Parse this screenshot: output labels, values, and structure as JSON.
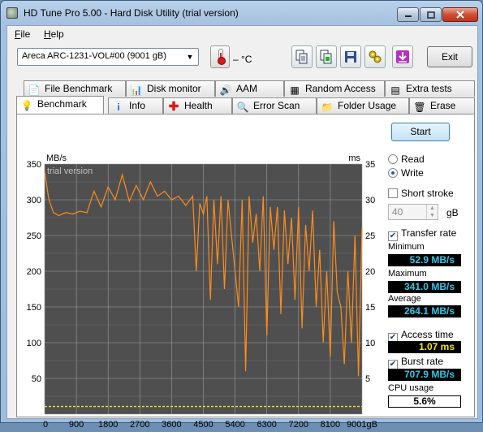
{
  "window": {
    "title": "HD Tune Pro 5.00 - Hard Disk Utility (trial version)"
  },
  "menu": [
    {
      "label": "File",
      "key": "F",
      "rest": "ile"
    },
    {
      "label": "Help",
      "key": "H",
      "rest": "elp"
    }
  ],
  "toolbar": {
    "drive": "Areca  ARC-1231-VOL#00  (9001 gB)",
    "temperature": "– °C",
    "icons": [
      "copy-info-icon",
      "copy-screenshot-icon",
      "save-icon",
      "options-icon",
      "download-icon"
    ],
    "exit_label": "Exit"
  },
  "tabs_top": [
    {
      "label": "File Benchmark",
      "icon": "file-benchmark-icon"
    },
    {
      "label": "Disk monitor",
      "icon": "disk-monitor-icon"
    },
    {
      "label": "AAM",
      "icon": "speaker-icon"
    },
    {
      "label": "Random Access",
      "icon": "random-access-icon"
    },
    {
      "label": "Extra tests",
      "icon": "extra-tests-icon"
    }
  ],
  "tabs_bottom": [
    {
      "label": "Benchmark",
      "icon": "benchmark-icon",
      "active": true
    },
    {
      "label": "Info",
      "icon": "info-icon"
    },
    {
      "label": "Health",
      "icon": "health-icon"
    },
    {
      "label": "Error Scan",
      "icon": "error-scan-icon"
    },
    {
      "label": "Folder Usage",
      "icon": "folder-icon"
    },
    {
      "label": "Erase",
      "icon": "trash-icon"
    }
  ],
  "controls": {
    "start_label": "Start",
    "read_label": "Read",
    "write_label": "Write",
    "mode": "Write",
    "short_stroke_label": "Short stroke",
    "short_stroke_checked": false,
    "short_stroke_value": "40",
    "short_stroke_unit": "gB",
    "transfer_rate_label": "Transfer rate",
    "transfer_rate_checked": true,
    "access_time_label": "Access time",
    "access_time_checked": true,
    "burst_rate_label": "Burst rate",
    "burst_rate_checked": true
  },
  "stats": {
    "minimum_label": "Minimum",
    "minimum": "52.9 MB/s",
    "maximum_label": "Maximum",
    "maximum": "341.0 MB/s",
    "average_label": "Average",
    "average": "264.1 MB/s",
    "access_time": "1.07 ms",
    "burst_rate": "707.9 MB/s",
    "cpu_label": "CPU usage",
    "cpu": "5.6%"
  },
  "chart_data": {
    "type": "line",
    "watermark": "trial version",
    "ylabel_left": "MB/s",
    "ylabel_right": "ms",
    "xlabel": "gB",
    "xlim": [
      0,
      9001
    ],
    "ylim_left": [
      0,
      350
    ],
    "ylim_right": [
      0,
      35
    ],
    "x_ticks": [
      "0",
      "900",
      "1800",
      "2700",
      "3600",
      "4500",
      "5400",
      "6300",
      "7200",
      "8100",
      "9001gB"
    ],
    "y_ticks_left": [
      "350",
      "300",
      "250",
      "200",
      "150",
      "100",
      "50"
    ],
    "y_ticks_right": [
      "35",
      "30",
      "25",
      "20",
      "15",
      "10",
      "5"
    ],
    "grid": true,
    "colors": {
      "transfer": "#ff8c1a",
      "access": "#f2e21a",
      "grid": "#9aa0a0",
      "background": "#4f4f4f"
    },
    "series": [
      {
        "name": "Transfer rate",
        "x": [
          0,
          120,
          250,
          400,
          600,
          800,
          1000,
          1200,
          1400,
          1600,
          1800,
          2000,
          2200,
          2400,
          2600,
          2800,
          3000,
          3200,
          3400,
          3600,
          3800,
          4000,
          4200,
          4300,
          4400,
          4500,
          4600,
          4700,
          4800,
          4900,
          5000,
          5100,
          5200,
          5300,
          5400,
          5500,
          5600,
          5700,
          5800,
          5900,
          6000,
          6100,
          6200,
          6300,
          6400,
          6500,
          6600,
          6700,
          6800,
          6900,
          7000,
          7100,
          7200,
          7300,
          7400,
          7500,
          7600,
          7700,
          7800,
          7900,
          8000,
          8100,
          8200,
          8300,
          8400,
          8500,
          8600,
          8700,
          8800,
          8900,
          9001
        ],
        "values": [
          340,
          300,
          282,
          278,
          282,
          280,
          284,
          282,
          312,
          290,
          318,
          300,
          335,
          298,
          320,
          300,
          325,
          305,
          312,
          300,
          305,
          292,
          305,
          200,
          295,
          280,
          305,
          160,
          300,
          210,
          305,
          175,
          300,
          250,
          200,
          150,
          300,
          60,
          305,
          240,
          280,
          200,
          305,
          110,
          290,
          230,
          290,
          140,
          285,
          210,
          275,
          160,
          290,
          120,
          265,
          200,
          285,
          150,
          230,
          100,
          200,
          80,
          270,
          170,
          150,
          70,
          200,
          100,
          250,
          52.9,
          260
        ]
      }
    ],
    "access_time_ms": 1.07,
    "burst_rate_mbs": 707.9
  }
}
